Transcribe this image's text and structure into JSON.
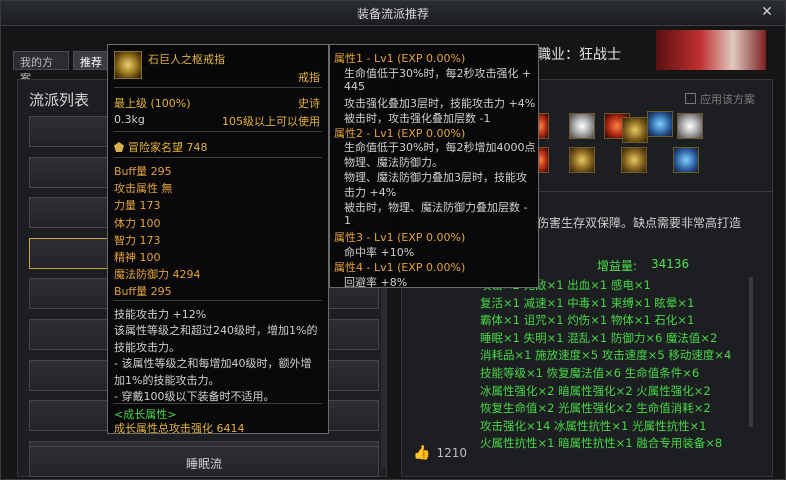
{
  "window": {
    "title": "装备流派推荐",
    "close_icon": "✕"
  },
  "tabs": [
    {
      "label": "我的方案"
    },
    {
      "label": "推荐"
    }
  ],
  "left": {
    "title": "流派列表",
    "buttons": [
      {
        "label": ""
      },
      {
        "label": ""
      },
      {
        "label": ""
      },
      {
        "label": ""
      },
      {
        "label": ""
      },
      {
        "label": ""
      },
      {
        "label": ""
      },
      {
        "label": ""
      },
      {
        "label": ""
      },
      {
        "label": "睡眠流"
      }
    ]
  },
  "right": {
    "job_text": "職业：狂战士",
    "apply_label": "应用该方案",
    "desc": "伤害生存双保障。缺点需要非常高打造",
    "gain_label": "增益量:",
    "gain_value": "34136",
    "stats_lines": [
      "攻击×2  无敌×1  出血×1  感电×1",
      "复活×1  减速×1  中毒×1  束缚×1  眩晕×1",
      "霸体×1  诅咒×1  灼伤×1  物体×1  石化×1",
      "睡眠×1  失明×1  混乱×1  防御力×6  魔法值×2",
      "消耗品×1  施放速度×5  攻击速度×5  移动速度×4",
      "技能等级×1  恢复魔法值×6  生命值条件×6",
      "冰属性强化×2  暗属性强化×2  火属性强化×2",
      "恢复生命值×2  光属性强化×2  生命值消耗×2",
      "攻击强化×14  冰属性抗性×1  光属性抗性×1",
      "火属性抗性×1  暗属性抗性×1  融合专用装备×8"
    ],
    "likes": "1210",
    "colors": {
      "gain": "#4ee04e",
      "stats": "#48d648"
    }
  },
  "tooltip_item": {
    "name": "石巨人之枢戒指",
    "slot": "戒指",
    "grade": "最上级 (100%)",
    "rarity": "史诗",
    "weight": "0.3kg",
    "level_req": "105级以上可以使用",
    "adventurer_fame": "冒险家名望 748",
    "stats": [
      "Buff量 295",
      "攻击属性 無",
      "力量 173",
      "体力 100",
      "智力 173",
      "精神 100",
      "魔法防御力 4294",
      "Buff量 295"
    ],
    "effect_lines": [
      "技能攻击力 +12%",
      "该属性等级之和超过240级时，增加1%的",
      "技能攻击力。",
      "- 该属性等级之和每增加40级时，额外增",
      "加1%的技能攻击力。",
      "- 穿戴100级以下装备时不适用。"
    ],
    "growth_title": "<成长属性>",
    "growth_total": "成长属性总攻击强化 6414"
  },
  "tooltip_growth": {
    "lines": [
      {
        "text": "属性1 - Lv1 (EXP 0.00%)",
        "head": true
      },
      {
        "text": "生命值低于30%时，每2秒攻击强化 +"
      },
      {
        "text": "445"
      },
      {
        "text": "攻击强化叠加3层时，技能攻击力 +4%"
      },
      {
        "text": "被击时，攻击强化叠加层数 -1"
      },
      {
        "text": "属性2 - Lv1 (EXP 0.00%)",
        "head": true
      },
      {
        "text": "生命值低于30%时，每2秒增加4000点"
      },
      {
        "text": "物理、魔法防御力。"
      },
      {
        "text": "物理、魔法防御力叠加3层时，技能攻"
      },
      {
        "text": "击力 +4%"
      },
      {
        "text": "被击时，物理、魔法防御力叠加层数 -"
      },
      {
        "text": "1"
      },
      {
        "text": "属性3 - Lv1 (EXP 0.00%)",
        "head": true
      },
      {
        "text": "命中率 +10%"
      },
      {
        "text": "属性4 - Lv1 (EXP 0.00%)",
        "head": true
      },
      {
        "text": "回避率 +8%"
      }
    ]
  }
}
